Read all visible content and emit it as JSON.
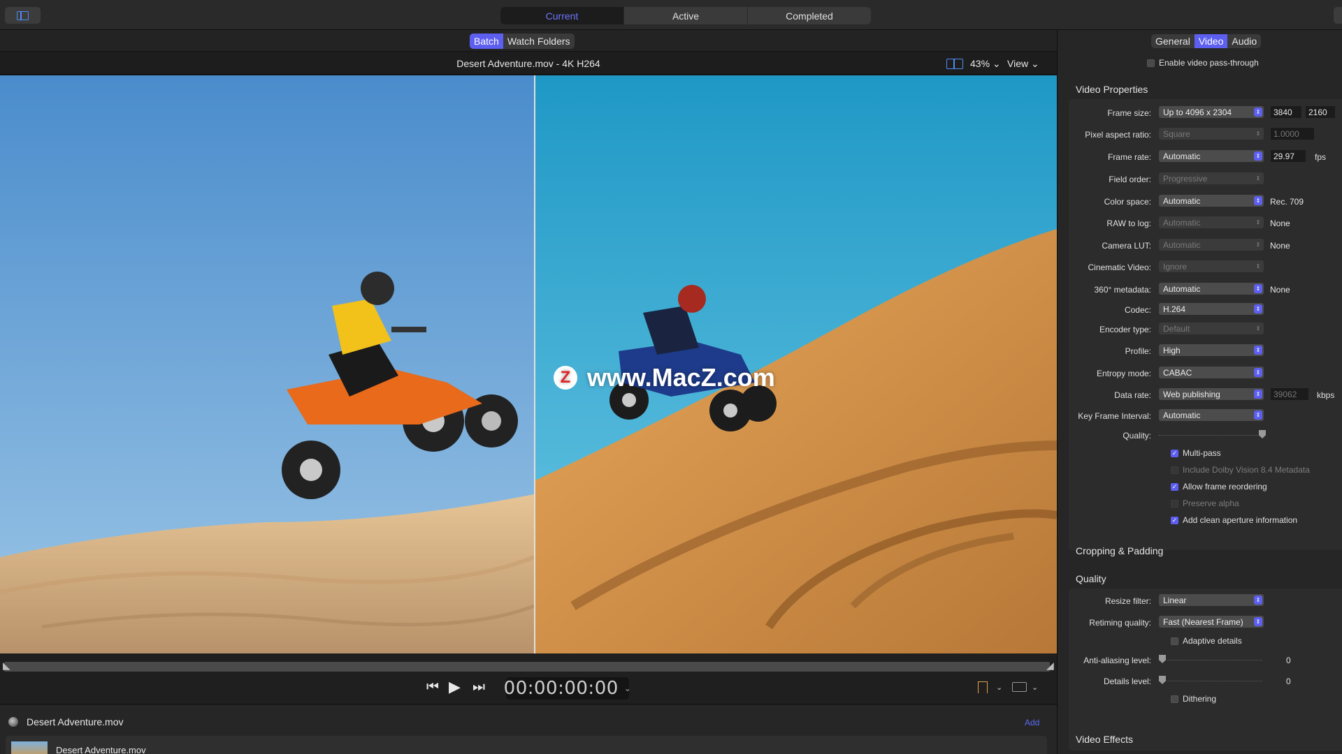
{
  "topbar": {
    "tabs": [
      "Current",
      "Active",
      "Completed"
    ],
    "active_tab": "Current"
  },
  "subbar": {
    "tabs": [
      "Batch",
      "Watch Folders"
    ],
    "active_tab": "Batch"
  },
  "viewer": {
    "title": "Desert Adventure.mov - 4K H264",
    "zoom": "43% ⌄",
    "view_menu": "View ⌄",
    "watermark": "www.MacZ.com",
    "watermark_badge": "Z"
  },
  "transport": {
    "timecode": "00:00:00:00",
    "timecode_chevron": "⌄",
    "prev": "⏮",
    "play": "▶",
    "next": "⏭"
  },
  "batch": {
    "header": "Desert Adventure.mov",
    "add_label": "Add",
    "row_name": "Desert Adventure.mov"
  },
  "inspector": {
    "tabs": [
      "General",
      "Video",
      "Audio"
    ],
    "active_tab": "Video",
    "passthrough": "Enable video pass-through",
    "video_properties_title": "Video Properties",
    "frame_size": {
      "label": "Frame size:",
      "value": "Up to 4096 x 2304",
      "width": "3840",
      "height": "2160"
    },
    "pixel_aspect": {
      "label": "Pixel aspect ratio:",
      "value": "Square",
      "num": "1.0000"
    },
    "frame_rate": {
      "label": "Frame rate:",
      "value": "Automatic",
      "num": "29.97",
      "unit": "fps"
    },
    "field_order": {
      "label": "Field order:",
      "value": "Progressive"
    },
    "color_space": {
      "label": "Color space:",
      "value": "Automatic",
      "extra": "Rec. 709"
    },
    "raw_to_log": {
      "label": "RAW to log:",
      "value": "Automatic",
      "extra": "None"
    },
    "camera_lut": {
      "label": "Camera LUT:",
      "value": "Automatic",
      "extra": "None"
    },
    "cinematic": {
      "label": "Cinematic Video:",
      "value": "Ignore"
    },
    "metadata360": {
      "label": "360° metadata:",
      "value": "Automatic",
      "extra": "None"
    },
    "codec": {
      "label": "Codec:",
      "value": "H.264"
    },
    "encoder_type": {
      "label": "Encoder type:",
      "value": "Default"
    },
    "profile": {
      "label": "Profile:",
      "value": "High"
    },
    "entropy": {
      "label": "Entropy mode:",
      "value": "CABAC"
    },
    "data_rate": {
      "label": "Data rate:",
      "value": "Web publishing",
      "num": "39062",
      "unit": "kbps"
    },
    "key_frame": {
      "label": "Key Frame Interval:",
      "value": "Automatic"
    },
    "quality_label": "Quality:",
    "checks": {
      "multipass": "Multi-pass",
      "dolby": "Include Dolby Vision 8.4 Metadata",
      "reorder": "Allow frame reordering",
      "alpha": "Preserve alpha",
      "aperture": "Add clean aperture information"
    },
    "cropping_title": "Cropping & Padding",
    "quality_title": "Quality",
    "resize": {
      "label": "Resize filter:",
      "value": "Linear"
    },
    "retiming": {
      "label": "Retiming quality:",
      "value": "Fast (Nearest Frame)"
    },
    "adaptive": "Adaptive details",
    "antialias": {
      "label": "Anti-aliasing level:",
      "value": "0"
    },
    "details": {
      "label": "Details level:",
      "value": "0"
    },
    "dithering": "Dithering",
    "effects_title": "Video Effects"
  },
  "colors": {
    "accent": "#5d5ff0",
    "active_tab_text": "#6f74ff",
    "sky_left": "#5f9fd6",
    "sky_right": "#37a9cf",
    "sand": "#d9a564"
  }
}
